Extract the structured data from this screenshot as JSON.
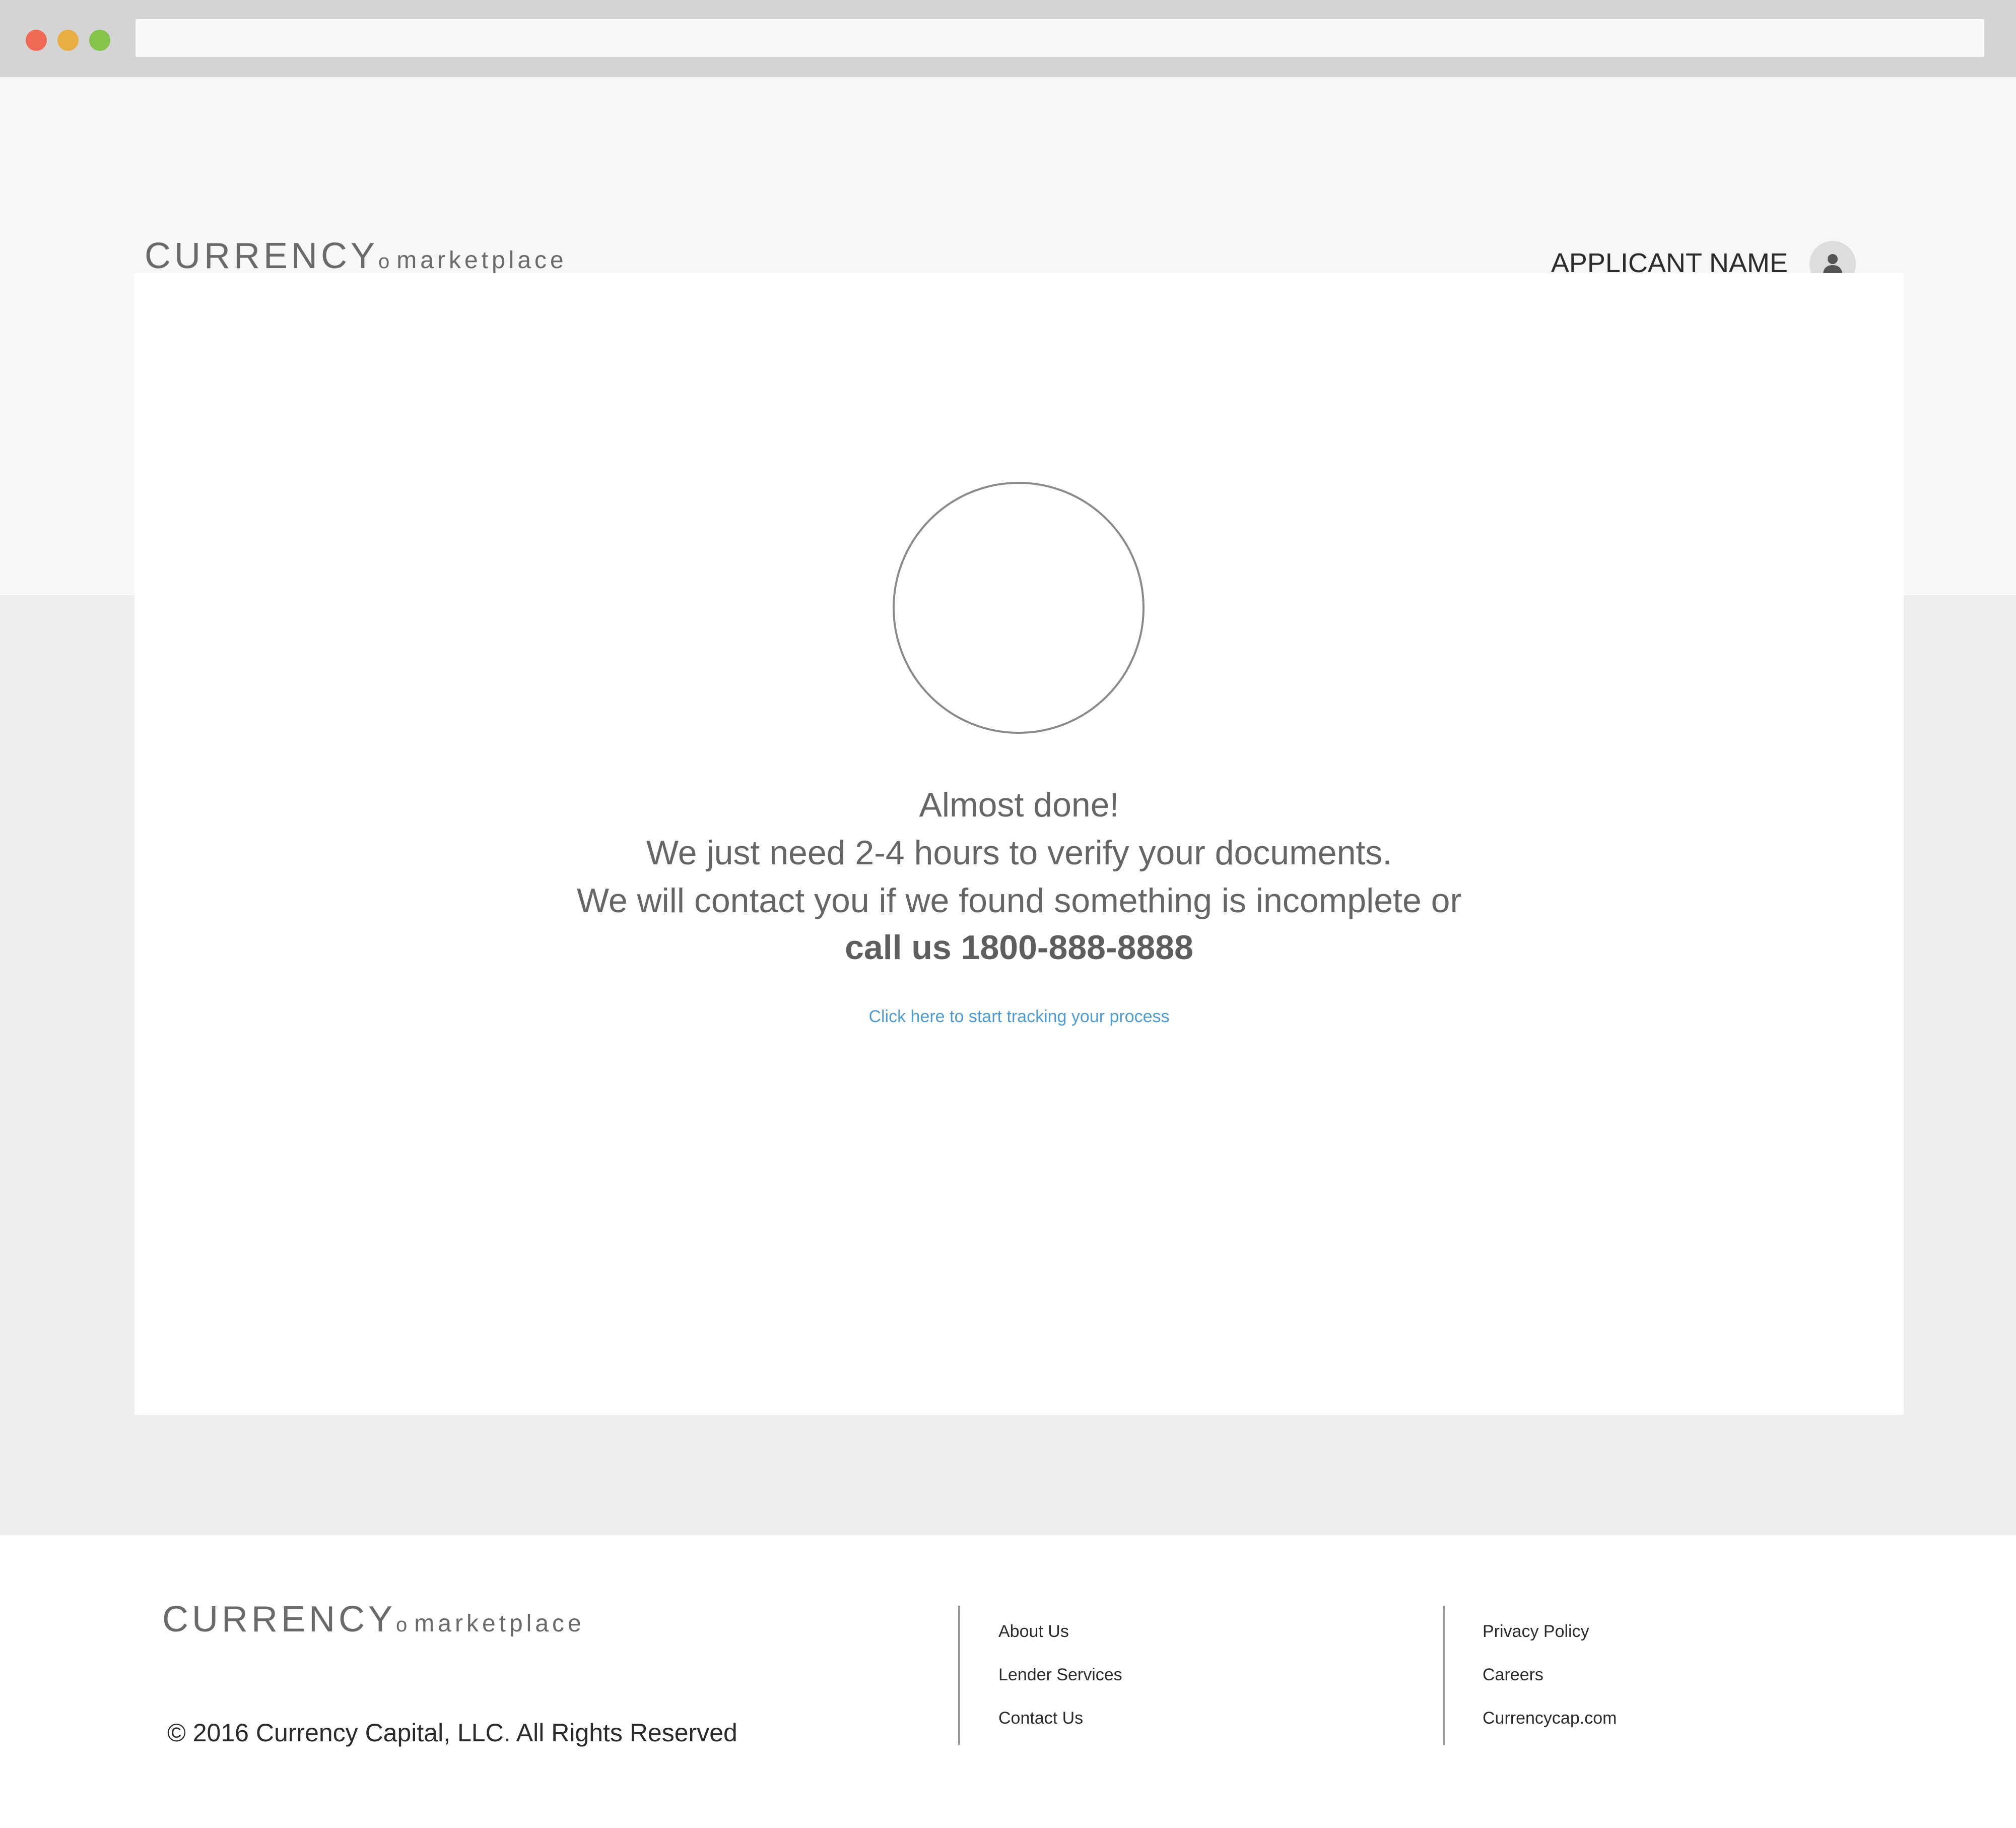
{
  "colors": {
    "traffic_red": "#ee6a55",
    "traffic_yellow": "#e8ae42",
    "traffic_green": "#84c44a",
    "link_blue": "#4d9bd6"
  },
  "header": {
    "logo": {
      "brand": "CURRENCY",
      "mark": "o",
      "sub": "marketplace"
    },
    "applicant_name": "APPLICANT NAME",
    "avatar_icon": "user-icon"
  },
  "main": {
    "message_lines": [
      "Almost done!",
      "We just need 2-4 hours to verify your documents.",
      "We will contact you if we found something is incomplete or",
      "call us 1800-888-8888"
    ],
    "tracking_link": "Click here to start tracking your process"
  },
  "footer": {
    "logo": {
      "brand": "CURRENCY",
      "mark": "o",
      "sub": "marketplace"
    },
    "copyright": "© 2016 Currency Capital, LLC. All Rights Reserved",
    "links_col1": [
      "About Us",
      "Lender Services",
      "Contact Us"
    ],
    "links_col2": [
      "Privacy Policy",
      "Careers",
      "Currencycap.com"
    ]
  }
}
